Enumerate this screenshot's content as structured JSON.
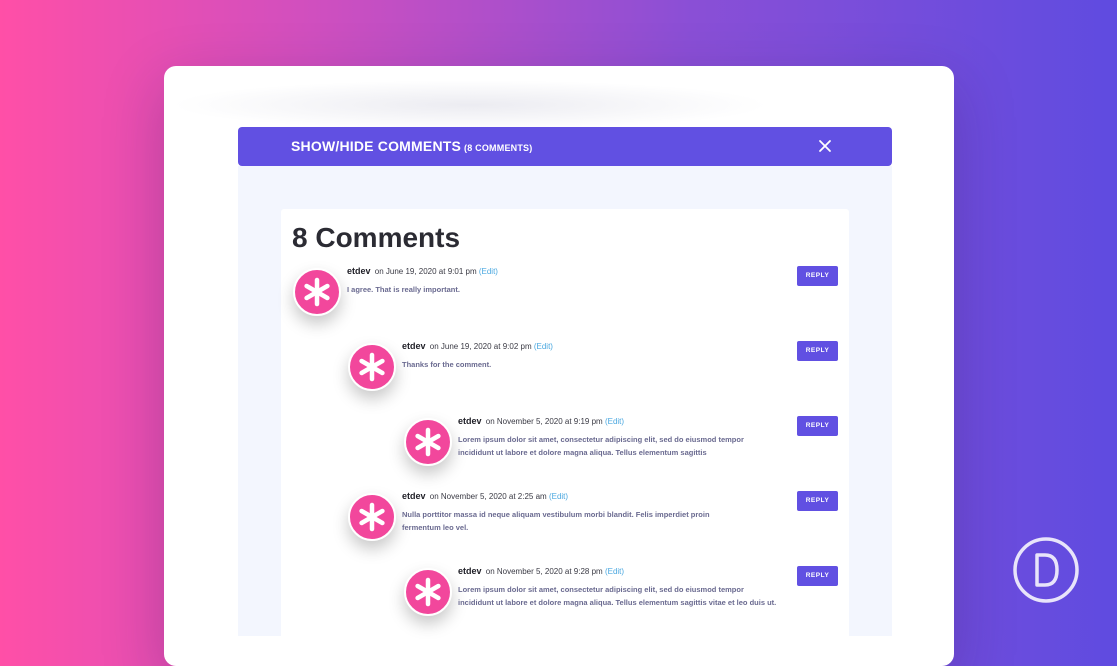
{
  "toggle": {
    "title": "SHOW/HIDE COMMENTS",
    "count": "(8 COMMENTS)",
    "close_icon": "close-icon"
  },
  "comments_section": {
    "heading": "8 Comments"
  },
  "comments": [
    {
      "author": "etdev",
      "date": "on June 19, 2020 at 9:01 pm",
      "edit_label": "(Edit)",
      "text": "I agree. That is really important.",
      "reply_label": "REPLY",
      "depth": 1
    },
    {
      "author": "etdev",
      "date": "on June 19, 2020 at 9:02 pm",
      "edit_label": "(Edit)",
      "text": "Thanks for the comment.",
      "reply_label": "REPLY",
      "depth": 2
    },
    {
      "author": "etdev",
      "date": "on November 5, 2020 at 9:19 pm",
      "edit_label": "(Edit)",
      "text": "Lorem ipsum dolor sit amet, consectetur adipiscing elit, sed do eiusmod tempor incididunt ut labore et dolore magna aliqua. Tellus elementum sagittis",
      "reply_label": "REPLY",
      "depth": 3
    },
    {
      "author": "etdev",
      "date": "on November 5, 2020 at 2:25 am",
      "edit_label": "(Edit)",
      "text": "Nulla porttitor massa id neque aliquam vestibulum morbi blandit. Felis imperdiet proin fermentum leo vel.",
      "reply_label": "REPLY",
      "depth": 2
    },
    {
      "author": "etdev",
      "date": "on November 5, 2020 at 9:28 pm",
      "edit_label": "(Edit)",
      "text": "Lorem ipsum dolor sit amet, consectetur adipiscing elit, sed do eiusmod tempor incididunt ut labore et dolore magna aliqua. Tellus elementum sagittis vitae et leo duis ut.",
      "reply_label": "REPLY",
      "depth": 3
    }
  ],
  "icons": {
    "avatar": "asterisk-avatar-icon",
    "logo": "divi-logo-icon"
  },
  "colors": {
    "accent": "#6150e2",
    "avatar": "#f2479c",
    "link": "#4ba8e0",
    "background_left": "#ff4fa7",
    "background_right": "#5f4be0"
  }
}
